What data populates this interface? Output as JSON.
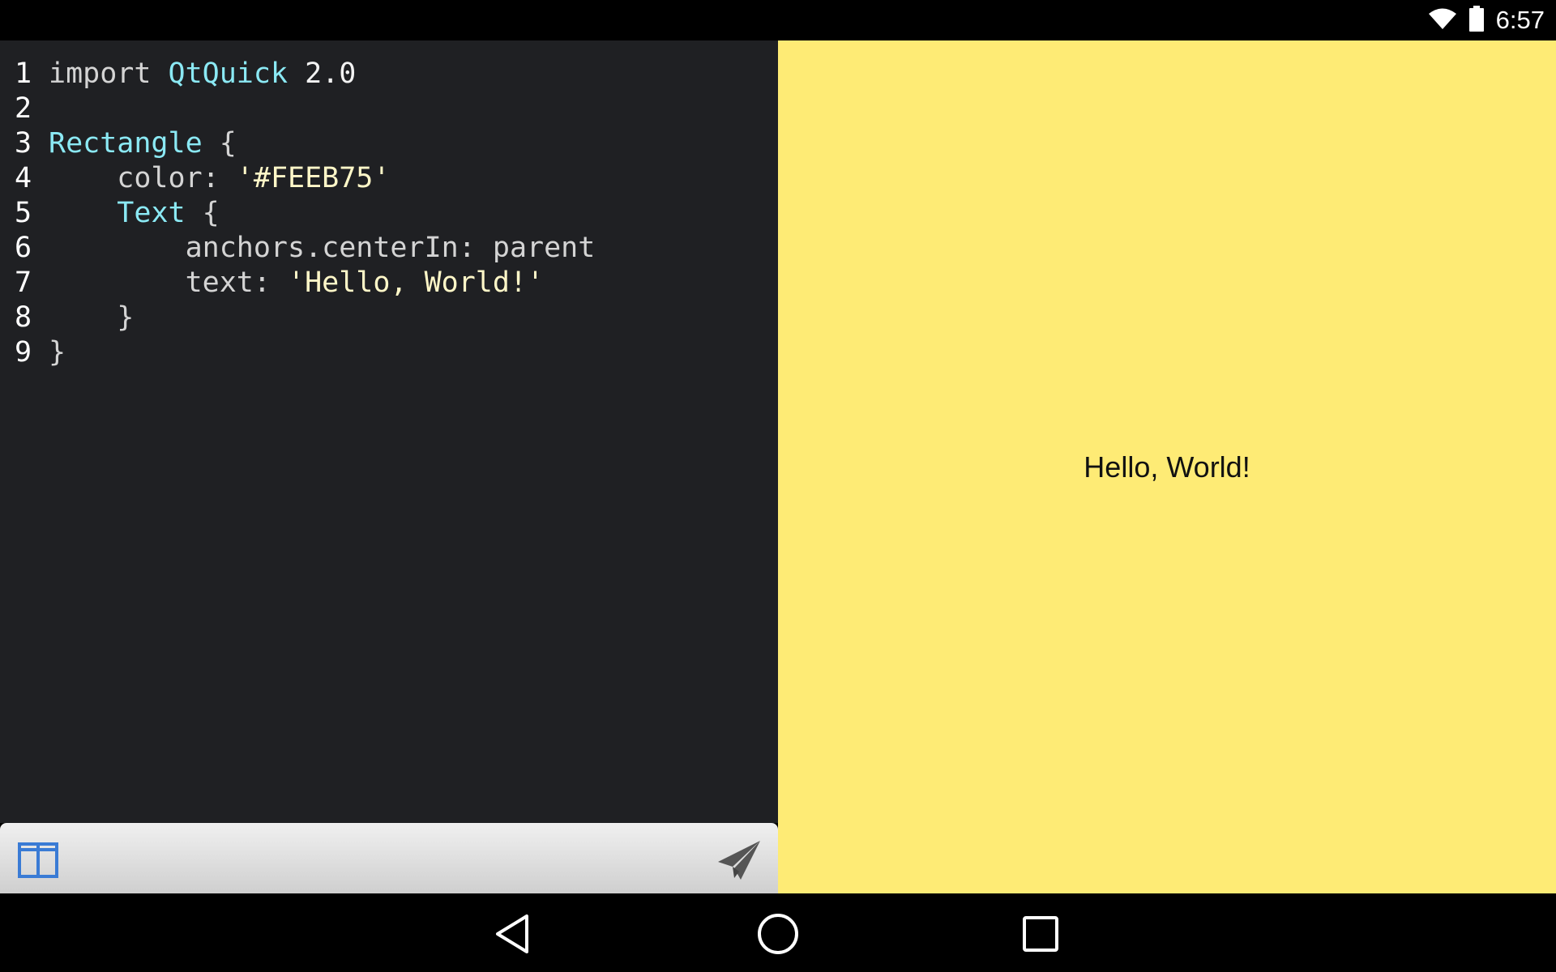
{
  "status_bar": {
    "time": "6:57",
    "icons": [
      "wifi-icon",
      "battery-icon"
    ]
  },
  "editor": {
    "lines": [
      {
        "number": "1",
        "tokens": [
          {
            "text": "import ",
            "kind": "plain"
          },
          {
            "text": "QtQuick",
            "kind": "type"
          },
          {
            "text": " 2.0",
            "kind": "num"
          }
        ]
      },
      {
        "number": "2",
        "tokens": []
      },
      {
        "number": "3",
        "tokens": [
          {
            "text": "Rectangle",
            "kind": "type"
          },
          {
            "text": " {",
            "kind": "plain"
          }
        ]
      },
      {
        "number": "4",
        "tokens": [
          {
            "text": "    color: ",
            "kind": "plain"
          },
          {
            "text": "'#FEEB75'",
            "kind": "str"
          }
        ]
      },
      {
        "number": "5",
        "tokens": [
          {
            "text": "    ",
            "kind": "plain"
          },
          {
            "text": "Text",
            "kind": "type"
          },
          {
            "text": " {",
            "kind": "plain"
          }
        ]
      },
      {
        "number": "6",
        "tokens": [
          {
            "text": "        anchors.centerIn: parent",
            "kind": "plain"
          }
        ]
      },
      {
        "number": "7",
        "tokens": [
          {
            "text": "        text: ",
            "kind": "plain"
          },
          {
            "text": "'Hello, World!'",
            "kind": "str"
          }
        ]
      },
      {
        "number": "8",
        "tokens": [
          {
            "text": "    }",
            "kind": "plain"
          }
        ]
      },
      {
        "number": "9",
        "tokens": [
          {
            "text": "}",
            "kind": "plain"
          }
        ]
      }
    ]
  },
  "preview": {
    "background": "#FEEB75",
    "text": "Hello, World!"
  },
  "toolbar": {
    "left_icon": "split-view-icon",
    "right_icon": "send-icon"
  },
  "navigation": {
    "buttons": [
      "back-icon",
      "home-icon",
      "recents-icon"
    ]
  },
  "colors": {
    "editor_bg": "#1f2023",
    "keyword": "#8be9f4",
    "string": "#fff7c8",
    "accent_blue": "#3a7bd5"
  }
}
